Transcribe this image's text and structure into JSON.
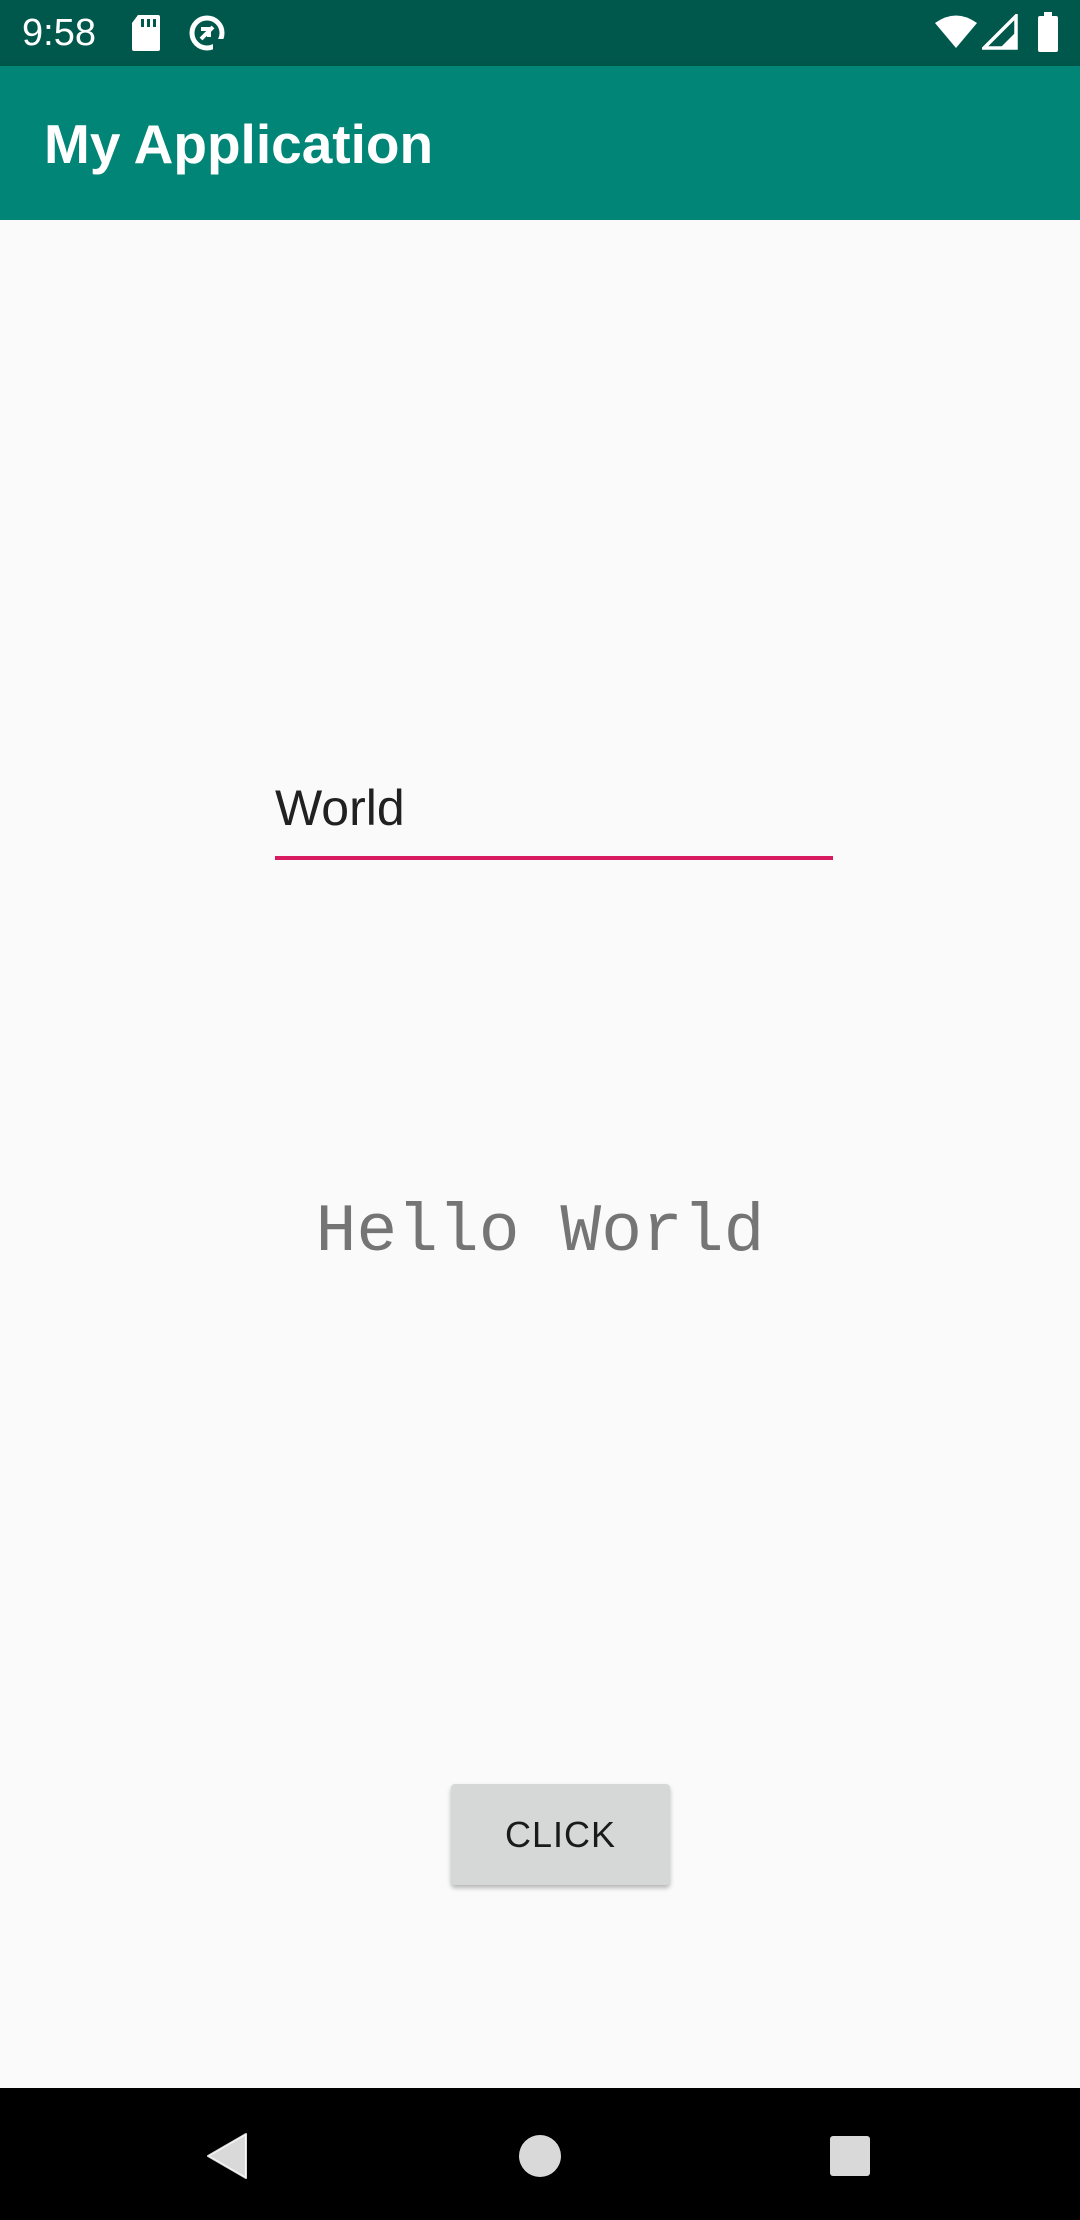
{
  "status_bar": {
    "time": "9:58",
    "icons": [
      "sd-card-icon",
      "data-saver-icon",
      "wifi-icon",
      "signal-icon",
      "battery-icon"
    ]
  },
  "app_bar": {
    "title": "My Application",
    "color": "#008577",
    "dark_color": "#00574b"
  },
  "main": {
    "input_value": "World",
    "accent_color": "#d81b60",
    "output_text": "Hello World",
    "button_label": "CLICK"
  },
  "nav_bar": {
    "buttons": [
      "back-icon",
      "home-icon",
      "recents-icon"
    ]
  }
}
